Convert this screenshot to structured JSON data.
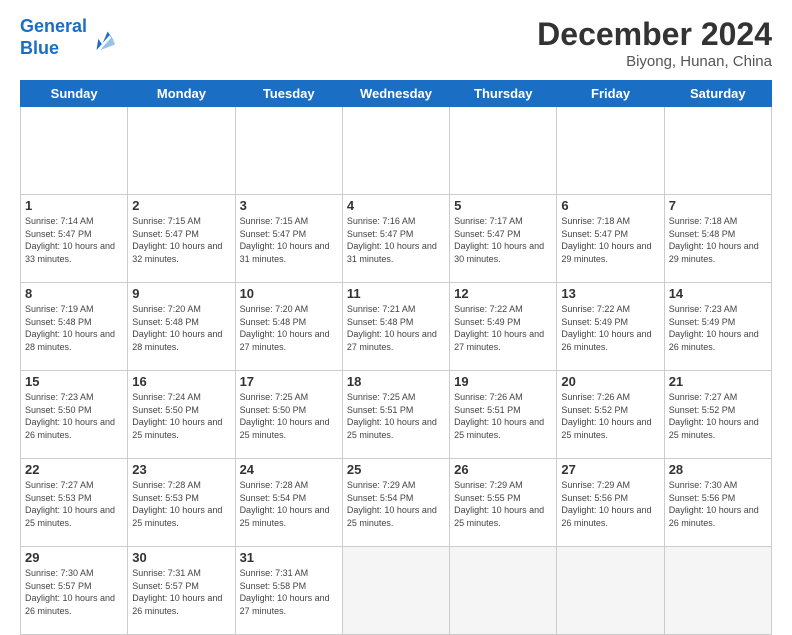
{
  "header": {
    "logo_line1": "General",
    "logo_line2": "Blue",
    "main_title": "December 2024",
    "subtitle": "Biyong, Hunan, China"
  },
  "calendar": {
    "days_of_week": [
      "Sunday",
      "Monday",
      "Tuesday",
      "Wednesday",
      "Thursday",
      "Friday",
      "Saturday"
    ],
    "weeks": [
      [
        {
          "day": "",
          "empty": true
        },
        {
          "day": "",
          "empty": true
        },
        {
          "day": "",
          "empty": true
        },
        {
          "day": "",
          "empty": true
        },
        {
          "day": "",
          "empty": true
        },
        {
          "day": "",
          "empty": true
        },
        {
          "day": "",
          "empty": true
        }
      ],
      [
        {
          "day": "1",
          "sunrise": "7:14 AM",
          "sunset": "5:47 PM",
          "daylight": "10 hours and 33 minutes."
        },
        {
          "day": "2",
          "sunrise": "7:15 AM",
          "sunset": "5:47 PM",
          "daylight": "10 hours and 32 minutes."
        },
        {
          "day": "3",
          "sunrise": "7:15 AM",
          "sunset": "5:47 PM",
          "daylight": "10 hours and 31 minutes."
        },
        {
          "day": "4",
          "sunrise": "7:16 AM",
          "sunset": "5:47 PM",
          "daylight": "10 hours and 31 minutes."
        },
        {
          "day": "5",
          "sunrise": "7:17 AM",
          "sunset": "5:47 PM",
          "daylight": "10 hours and 30 minutes."
        },
        {
          "day": "6",
          "sunrise": "7:18 AM",
          "sunset": "5:47 PM",
          "daylight": "10 hours and 29 minutes."
        },
        {
          "day": "7",
          "sunrise": "7:18 AM",
          "sunset": "5:48 PM",
          "daylight": "10 hours and 29 minutes."
        }
      ],
      [
        {
          "day": "8",
          "sunrise": "7:19 AM",
          "sunset": "5:48 PM",
          "daylight": "10 hours and 28 minutes."
        },
        {
          "day": "9",
          "sunrise": "7:20 AM",
          "sunset": "5:48 PM",
          "daylight": "10 hours and 28 minutes."
        },
        {
          "day": "10",
          "sunrise": "7:20 AM",
          "sunset": "5:48 PM",
          "daylight": "10 hours and 27 minutes."
        },
        {
          "day": "11",
          "sunrise": "7:21 AM",
          "sunset": "5:48 PM",
          "daylight": "10 hours and 27 minutes."
        },
        {
          "day": "12",
          "sunrise": "7:22 AM",
          "sunset": "5:49 PM",
          "daylight": "10 hours and 27 minutes."
        },
        {
          "day": "13",
          "sunrise": "7:22 AM",
          "sunset": "5:49 PM",
          "daylight": "10 hours and 26 minutes."
        },
        {
          "day": "14",
          "sunrise": "7:23 AM",
          "sunset": "5:49 PM",
          "daylight": "10 hours and 26 minutes."
        }
      ],
      [
        {
          "day": "15",
          "sunrise": "7:23 AM",
          "sunset": "5:50 PM",
          "daylight": "10 hours and 26 minutes."
        },
        {
          "day": "16",
          "sunrise": "7:24 AM",
          "sunset": "5:50 PM",
          "daylight": "10 hours and 25 minutes."
        },
        {
          "day": "17",
          "sunrise": "7:25 AM",
          "sunset": "5:50 PM",
          "daylight": "10 hours and 25 minutes."
        },
        {
          "day": "18",
          "sunrise": "7:25 AM",
          "sunset": "5:51 PM",
          "daylight": "10 hours and 25 minutes."
        },
        {
          "day": "19",
          "sunrise": "7:26 AM",
          "sunset": "5:51 PM",
          "daylight": "10 hours and 25 minutes."
        },
        {
          "day": "20",
          "sunrise": "7:26 AM",
          "sunset": "5:52 PM",
          "daylight": "10 hours and 25 minutes."
        },
        {
          "day": "21",
          "sunrise": "7:27 AM",
          "sunset": "5:52 PM",
          "daylight": "10 hours and 25 minutes."
        }
      ],
      [
        {
          "day": "22",
          "sunrise": "7:27 AM",
          "sunset": "5:53 PM",
          "daylight": "10 hours and 25 minutes."
        },
        {
          "day": "23",
          "sunrise": "7:28 AM",
          "sunset": "5:53 PM",
          "daylight": "10 hours and 25 minutes."
        },
        {
          "day": "24",
          "sunrise": "7:28 AM",
          "sunset": "5:54 PM",
          "daylight": "10 hours and 25 minutes."
        },
        {
          "day": "25",
          "sunrise": "7:29 AM",
          "sunset": "5:54 PM",
          "daylight": "10 hours and 25 minutes."
        },
        {
          "day": "26",
          "sunrise": "7:29 AM",
          "sunset": "5:55 PM",
          "daylight": "10 hours and 25 minutes."
        },
        {
          "day": "27",
          "sunrise": "7:29 AM",
          "sunset": "5:56 PM",
          "daylight": "10 hours and 26 minutes."
        },
        {
          "day": "28",
          "sunrise": "7:30 AM",
          "sunset": "5:56 PM",
          "daylight": "10 hours and 26 minutes."
        }
      ],
      [
        {
          "day": "29",
          "sunrise": "7:30 AM",
          "sunset": "5:57 PM",
          "daylight": "10 hours and 26 minutes."
        },
        {
          "day": "30",
          "sunrise": "7:31 AM",
          "sunset": "5:57 PM",
          "daylight": "10 hours and 26 minutes."
        },
        {
          "day": "31",
          "sunrise": "7:31 AM",
          "sunset": "5:58 PM",
          "daylight": "10 hours and 27 minutes."
        },
        {
          "day": "",
          "empty": true
        },
        {
          "day": "",
          "empty": true
        },
        {
          "day": "",
          "empty": true
        },
        {
          "day": "",
          "empty": true
        }
      ]
    ]
  }
}
